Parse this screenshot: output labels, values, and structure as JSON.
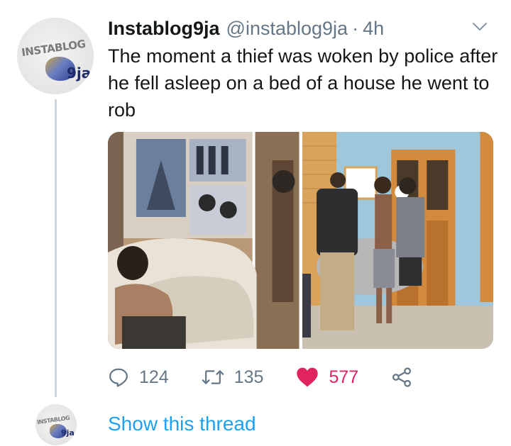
{
  "tweet": {
    "display_name": "Instablog9ja",
    "handle": "@instablog9ja",
    "separator": "·",
    "time": "4h",
    "text": "The moment a thief was woken by police after he fell asleep on a bed of a house he went to rob",
    "avatar_logo_text": "INSTABLOG",
    "avatar_logo_num": "9ja",
    "media": [
      {
        "description_icon": "photo-bedroom"
      },
      {
        "description_icon": "photo-arrest"
      }
    ],
    "actions": {
      "reply_count": "124",
      "retweet_count": "135",
      "like_count": "577"
    },
    "colors": {
      "like": "#e0245e",
      "link": "#1da1f2",
      "muted": "#657786",
      "thread_line": "#ccd6dd"
    }
  },
  "thread": {
    "show_thread_label": "Show this thread",
    "avatar_logo_text": "INSTABLOG",
    "avatar_logo_num": "9ja"
  }
}
